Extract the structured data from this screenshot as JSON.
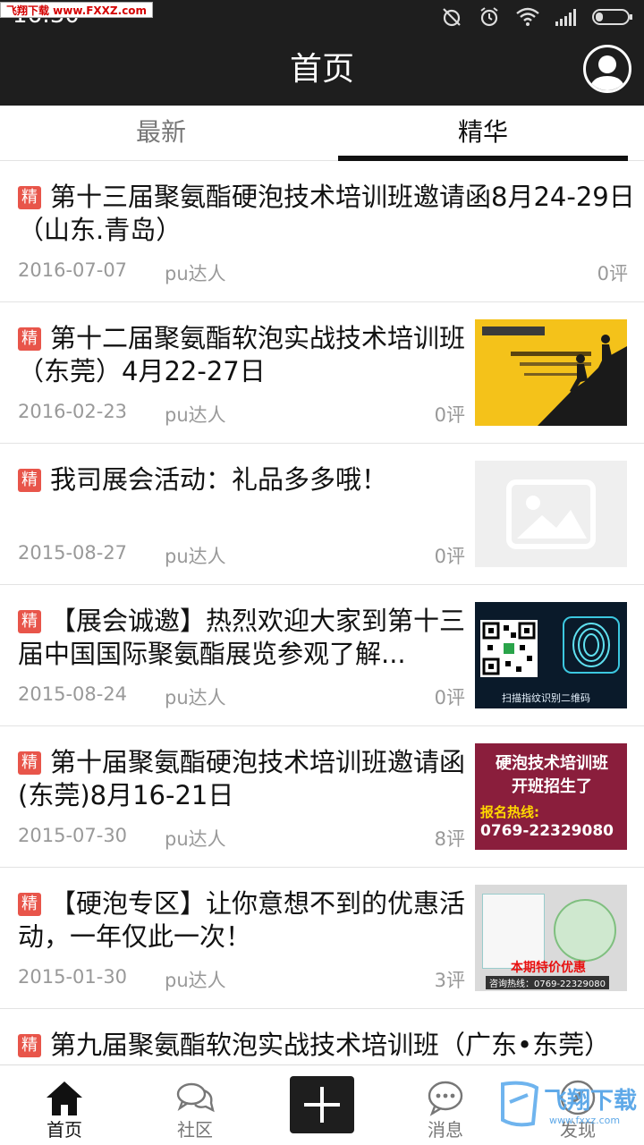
{
  "status_bar": {
    "time": "16:30",
    "watermark": "飞翔下载 www.FXXZ.com"
  },
  "header": {
    "title": "首页"
  },
  "tabs": [
    {
      "label": "最新",
      "active": false
    },
    {
      "label": "精华",
      "active": true
    }
  ],
  "articles": [
    {
      "tag": "精",
      "title": "第十三届聚氨酯硬泡技术培训班邀请函8月24-29日（山东.青岛）",
      "date": "2016-07-07",
      "author": "pu达人",
      "comments": "0评",
      "has_thumb": false
    },
    {
      "tag": "精",
      "title": "第十二届聚氨酯软泡实战技术培训班（东莞）4月22-27日",
      "date": "2016-02-23",
      "author": "pu达人",
      "comments": "0评",
      "has_thumb": true
    },
    {
      "tag": "精",
      "title": "我司展会活动：礼品多多哦！",
      "date": "2015-08-27",
      "author": "pu达人",
      "comments": "0评",
      "has_thumb": true
    },
    {
      "tag": "精",
      "title": "【展会诚邀】热烈欢迎大家到第十三届中国国际聚氨酯展览参观了解...",
      "date": "2015-08-24",
      "author": "pu达人",
      "comments": "0评",
      "has_thumb": true
    },
    {
      "tag": "精",
      "title": "第十届聚氨酯硬泡技术培训班邀请函(东莞)8月16-21日",
      "date": "2015-07-30",
      "author": "pu达人",
      "comments": "8评",
      "has_thumb": true
    },
    {
      "tag": "精",
      "title": "【硬泡专区】让你意想不到的优惠活动，一年仅此一次！",
      "date": "2015-01-30",
      "author": "pu达人",
      "comments": "3评",
      "has_thumb": true
    },
    {
      "tag": "精",
      "title": "第九届聚氨酯软泡实战技术培训班（广东•东莞）",
      "date": "",
      "author": "",
      "comments": "",
      "has_thumb": false
    }
  ],
  "thumbs": {
    "qr_caption": "扫描指纹识别二维码",
    "red_line1": "硬泡技术培训班",
    "red_line2": "开班招生了",
    "red_line3": "报名热线:",
    "red_line4": "0769-22329080",
    "promo": "本期特价优惠",
    "promo_phone": "咨询热线：0769-22329080"
  },
  "bottom_nav": {
    "home": "首页",
    "community": "社区",
    "messages": "消息",
    "discover": "发现"
  },
  "watermark_bottom": {
    "text": "飞翔下载",
    "url": "www.fxxz.com"
  },
  "colors": {
    "bar": "#1e1e1e",
    "tag": "#e8554a",
    "meta": "#999999"
  }
}
